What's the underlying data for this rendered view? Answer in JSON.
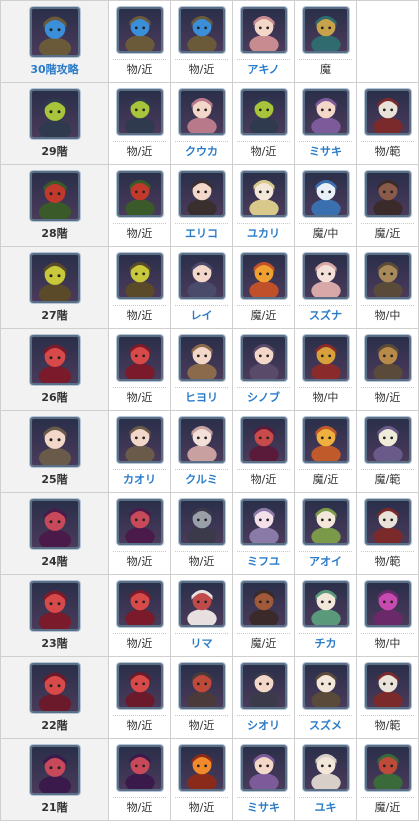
{
  "colors": {
    "link": "#2a7bc9",
    "text": "#333333",
    "floor_bg": "#f2f2f2",
    "border": "#cfcfcf",
    "icon_frame": "#5a6f86"
  },
  "rows": [
    {
      "floor": {
        "label": "30階攻略",
        "link": true,
        "icon": "golem-mech-icon",
        "c1": "#6b5a3a",
        "c2": "#3b8fd8"
      },
      "cells": [
        {
          "label": "物/近",
          "link": false,
          "icon": "golem-mech-icon",
          "c1": "#6b5a3a",
          "c2": "#3b8fd8"
        },
        {
          "label": "物/近",
          "link": false,
          "icon": "golem-mech-icon",
          "c1": "#6b5a3a",
          "c2": "#3b8fd8"
        },
        {
          "label": "アキノ",
          "link": true,
          "icon": "girl-pink-hair-icon",
          "c1": "#c88b8f",
          "c2": "#f3d7c9"
        },
        {
          "label": "魔",
          "link": false,
          "icon": "tiki-totem-icon",
          "c1": "#2f6b6f",
          "c2": "#c7a24a"
        },
        null
      ]
    },
    {
      "floor": {
        "label": "29階",
        "link": false,
        "icon": "mantis-plant-icon",
        "c1": "#2f3a4f",
        "c2": "#a8c43a"
      },
      "cells": [
        {
          "label": "物/近",
          "link": false,
          "icon": "mantis-plant-icon",
          "c1": "#2f3a4f",
          "c2": "#a8c43a"
        },
        {
          "label": "クウカ",
          "link": true,
          "icon": "girl-pink-hair-icon",
          "c1": "#b87a8a",
          "c2": "#f3d7c9"
        },
        {
          "label": "物/近",
          "link": false,
          "icon": "mantis-plant-icon",
          "c1": "#2f3a4f",
          "c2": "#a8c43a"
        },
        {
          "label": "ミサキ",
          "link": true,
          "icon": "girl-purple-hair-icon",
          "c1": "#7d5a9a",
          "c2": "#f3d7c9"
        },
        {
          "label": "物/範",
          "link": false,
          "icon": "beast-red-white-icon",
          "c1": "#7a2a2a",
          "c2": "#e8e2d8"
        }
      ]
    },
    {
      "floor": {
        "label": "28階",
        "link": false,
        "icon": "vine-plant-icon",
        "c1": "#3a5a2a",
        "c2": "#c0392b"
      },
      "cells": [
        {
          "label": "物/近",
          "link": false,
          "icon": "vine-plant-icon",
          "c1": "#3a5a2a",
          "c2": "#c0392b"
        },
        {
          "label": "エリコ",
          "link": true,
          "icon": "girl-dark-hair-icon",
          "c1": "#3a2f2f",
          "c2": "#f3d7c9"
        },
        {
          "label": "ユカリ",
          "link": true,
          "icon": "girl-blonde-hair-icon",
          "c1": "#d8c88a",
          "c2": "#f3e7d9"
        },
        {
          "label": "魔/中",
          "link": false,
          "icon": "ice-bird-icon",
          "c1": "#3a6fb0",
          "c2": "#e8f0f8"
        },
        {
          "label": "魔/近",
          "link": false,
          "icon": "dark-beast-icon",
          "c1": "#3a2a2a",
          "c2": "#8a5a4a"
        }
      ]
    },
    {
      "floor": {
        "label": "27階",
        "link": false,
        "icon": "tree-monster-icon",
        "c1": "#5a4a2a",
        "c2": "#c8c83a"
      },
      "cells": [
        {
          "label": "物/近",
          "link": false,
          "icon": "tree-monster-icon",
          "c1": "#5a4a2a",
          "c2": "#c8c83a"
        },
        {
          "label": "レイ",
          "link": true,
          "icon": "girl-dark-hair-icon",
          "c1": "#4a4a6a",
          "c2": "#f3d7c9"
        },
        {
          "label": "魔/近",
          "link": false,
          "icon": "fire-imp-icon",
          "c1": "#c0502a",
          "c2": "#f0a030"
        },
        {
          "label": "スズナ",
          "link": true,
          "icon": "girl-pink-hair-icon",
          "c1": "#d8a8a8",
          "c2": "#f3e0d8"
        },
        {
          "label": "物/中",
          "link": false,
          "icon": "rock-golem-icon",
          "c1": "#5a4a3a",
          "c2": "#a88a5a"
        }
      ]
    },
    {
      "floor": {
        "label": "26階",
        "link": false,
        "icon": "red-dragon-icon",
        "c1": "#7a1a2a",
        "c2": "#d84a4a"
      },
      "cells": [
        {
          "label": "物/近",
          "link": false,
          "icon": "red-dragon-icon",
          "c1": "#7a1a2a",
          "c2": "#d84a4a"
        },
        {
          "label": "ヒヨリ",
          "link": true,
          "icon": "girl-brown-hair-icon",
          "c1": "#8a6a4a",
          "c2": "#f3d7c9"
        },
        {
          "label": "シノブ",
          "link": true,
          "icon": "girl-purple-hair-icon",
          "c1": "#5a4a6a",
          "c2": "#f3d7c9"
        },
        {
          "label": "物/中",
          "link": false,
          "icon": "red-demon-icon",
          "c1": "#8a2a2a",
          "c2": "#d8a03a"
        },
        {
          "label": "物/近",
          "link": false,
          "icon": "crate-golem-icon",
          "c1": "#5a4a3a",
          "c2": "#b88a4a"
        }
      ]
    },
    {
      "floor": {
        "label": "25階",
        "link": false,
        "icon": "girl-brown-hair-icon",
        "c1": "#6a5a4a",
        "c2": "#f3d7c9"
      },
      "cells": [
        {
          "label": "カオリ",
          "link": true,
          "icon": "girl-brown-hair-icon",
          "c1": "#6a5a4a",
          "c2": "#f3d7c9"
        },
        {
          "label": "クルミ",
          "link": true,
          "icon": "girl-pink-hair-icon",
          "c1": "#c8a0a0",
          "c2": "#f3e0d8"
        },
        {
          "label": "物/近",
          "link": false,
          "icon": "red-dragon-icon",
          "c1": "#5a1a3a",
          "c2": "#c84a4a"
        },
        {
          "label": "魔/近",
          "link": false,
          "icon": "fire-imp-icon",
          "c1": "#c05a2a",
          "c2": "#f0b040"
        },
        {
          "label": "魔/範",
          "link": false,
          "icon": "white-beast-icon",
          "c1": "#6a5a8a",
          "c2": "#f0ead8"
        }
      ]
    },
    {
      "floor": {
        "label": "24階",
        "link": false,
        "icon": "red-dragon-icon",
        "c1": "#4a1a4a",
        "c2": "#c84a5a"
      },
      "cells": [
        {
          "label": "物/近",
          "link": false,
          "icon": "red-dragon-icon",
          "c1": "#4a1a4a",
          "c2": "#c84a5a"
        },
        {
          "label": "物/近",
          "link": false,
          "icon": "wolf-beast-icon",
          "c1": "#3a3a4a",
          "c2": "#9aa0a8"
        },
        {
          "label": "ミフユ",
          "link": true,
          "icon": "girl-purple-hair-icon",
          "c1": "#8a7aa8",
          "c2": "#f3e0e8"
        },
        {
          "label": "アオイ",
          "link": true,
          "icon": "girl-green-hat-icon",
          "c1": "#7a9a4a",
          "c2": "#f3e7d9"
        },
        {
          "label": "物/範",
          "link": false,
          "icon": "beast-red-white-icon",
          "c1": "#7a2a2a",
          "c2": "#e8e2d8"
        }
      ]
    },
    {
      "floor": {
        "label": "23階",
        "link": false,
        "icon": "red-dragon-icon",
        "c1": "#7a1a2a",
        "c2": "#d84a4a"
      },
      "cells": [
        {
          "label": "物/近",
          "link": false,
          "icon": "red-dragon-icon",
          "c1": "#7a1a2a",
          "c2": "#d84a4a"
        },
        {
          "label": "リマ",
          "link": true,
          "icon": "girl-white-hair-icon",
          "c1": "#e8e0e0",
          "c2": "#c04a4a"
        },
        {
          "label": "魔/近",
          "link": false,
          "icon": "dark-beast-icon",
          "c1": "#3a2a2a",
          "c2": "#a05a3a"
        },
        {
          "label": "チカ",
          "link": true,
          "icon": "girl-green-hair-icon",
          "c1": "#5a9a7a",
          "c2": "#f3e7d9"
        },
        {
          "label": "物/中",
          "link": false,
          "icon": "purple-demon-icon",
          "c1": "#6a2a6a",
          "c2": "#c84ab0"
        }
      ]
    },
    {
      "floor": {
        "label": "22階",
        "link": false,
        "icon": "red-dragon-icon",
        "c1": "#6a1a2a",
        "c2": "#d84a4a"
      },
      "cells": [
        {
          "label": "物/近",
          "link": false,
          "icon": "red-dragon-icon",
          "c1": "#6a1a2a",
          "c2": "#d84a4a"
        },
        {
          "label": "物/近",
          "link": false,
          "icon": "armored-brute-icon",
          "c1": "#4a3a3a",
          "c2": "#c04a3a"
        },
        {
          "label": "シオリ",
          "link": true,
          "icon": "girl-dark-hair-icon",
          "c1": "#3a3a4a",
          "c2": "#f3d7c9"
        },
        {
          "label": "スズメ",
          "link": true,
          "icon": "girl-maid-icon",
          "c1": "#5a4a3a",
          "c2": "#f3e7d9"
        },
        {
          "label": "物/範",
          "link": false,
          "icon": "beast-red-white-icon",
          "c1": "#7a2a2a",
          "c2": "#e8e2d8"
        }
      ]
    },
    {
      "floor": {
        "label": "21階",
        "link": false,
        "icon": "red-dragon-icon",
        "c1": "#3a1a4a",
        "c2": "#c84a5a"
      },
      "cells": [
        {
          "label": "物/近",
          "link": false,
          "icon": "red-dragon-icon",
          "c1": "#3a1a4a",
          "c2": "#c84a5a"
        },
        {
          "label": "物/近",
          "link": false,
          "icon": "fire-dragon-icon",
          "c1": "#8a2a1a",
          "c2": "#f08a2a"
        },
        {
          "label": "ミサキ",
          "link": true,
          "icon": "girl-purple-hair-icon",
          "c1": "#7d5a9a",
          "c2": "#f3d7c9"
        },
        {
          "label": "ユキ",
          "link": true,
          "icon": "girl-white-hair-icon",
          "c1": "#d8d0c8",
          "c2": "#f3e7d9"
        },
        {
          "label": "魔/近",
          "link": false,
          "icon": "green-ogre-icon",
          "c1": "#3a6a3a",
          "c2": "#c04a3a"
        }
      ]
    }
  ]
}
